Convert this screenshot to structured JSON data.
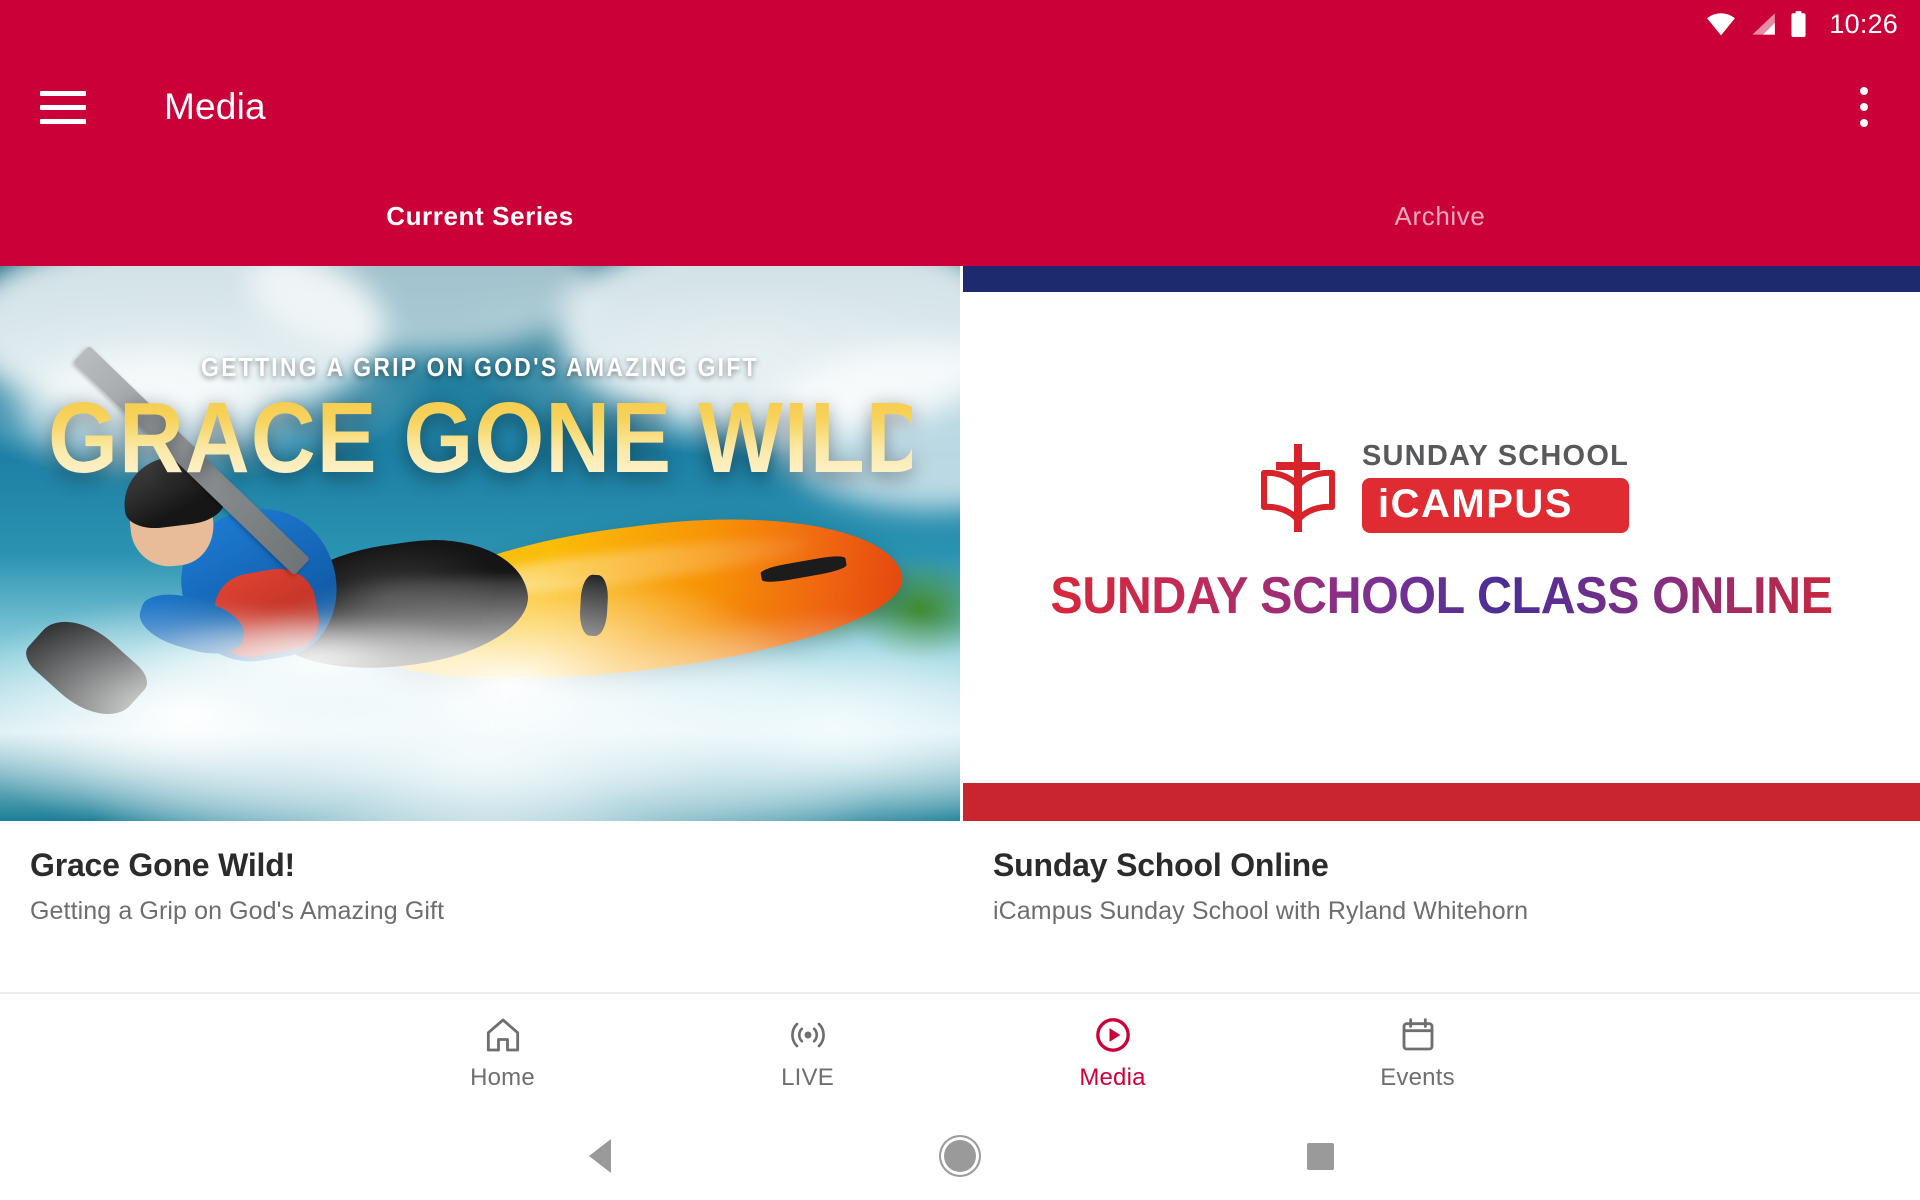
{
  "status_bar": {
    "time": "10:26",
    "icons": [
      "wifi-icon",
      "cellular-signal-icon",
      "battery-icon"
    ]
  },
  "app_bar": {
    "menu_icon": "hamburger-menu-icon",
    "title": "Media",
    "overflow_icon": "more-vertical-icon",
    "background_color": "#CC0038"
  },
  "tabs": [
    {
      "label": "Current Series",
      "active": true
    },
    {
      "label": "Archive",
      "active": false
    }
  ],
  "cards": [
    {
      "title": "Grace Gone Wild!",
      "subtitle": "Getting a Grip on God's Amazing Gift",
      "artwork": {
        "kicker": "GETTING A GRIP ON GOD'S AMAZING GIFT",
        "headline": "GRACE GONE WILD!",
        "scene": "whitewater-kayaker-photo",
        "headline_color": "#F5C842"
      }
    },
    {
      "title": "Sunday School Online",
      "subtitle": "iCampus Sunday School with Ryland Whitehorn",
      "artwork": {
        "logo_top_line": "SUNDAY SCHOOL",
        "logo_badge": "iCAMPUS",
        "tagline": "SUNDAY SCHOOL CLASS ONLINE",
        "mark": "cross-and-open-book-icon",
        "band_top_color": "#1D2B6E",
        "band_bottom_color": "#C8252F",
        "badge_color": "#E02B33"
      }
    }
  ],
  "bottom_nav": [
    {
      "label": "Home",
      "icon": "home-icon",
      "active": false
    },
    {
      "label": "LIVE",
      "icon": "broadcast-icon",
      "active": false
    },
    {
      "label": "Media",
      "icon": "play-circle-icon",
      "active": true
    },
    {
      "label": "Events",
      "icon": "calendar-icon",
      "active": false
    }
  ],
  "system_nav": [
    {
      "name": "back-button",
      "icon": "triangle-back-icon"
    },
    {
      "name": "home-button",
      "icon": "circle-home-icon"
    },
    {
      "name": "recents-button",
      "icon": "square-recents-icon"
    }
  ],
  "accent_color": "#CC0038"
}
